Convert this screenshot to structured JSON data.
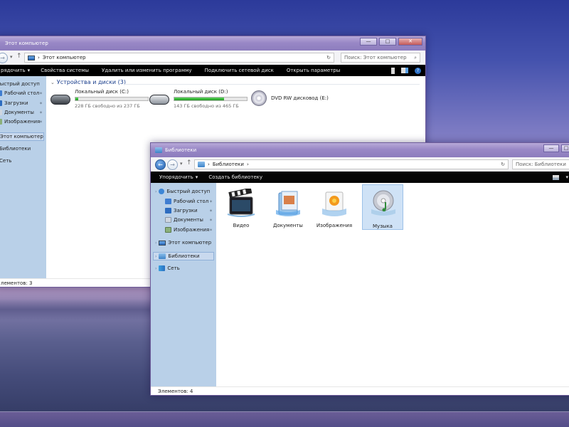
{
  "window_pc": {
    "title": "Этот компьютер",
    "address": "Этот компьютер",
    "search_placeholder": "Поиск: Этот компьютер",
    "toolbar": [
      "Свойства системы",
      "Удалить или изменить программу",
      "Подключить сетевой диск",
      "Открыть параметры"
    ],
    "toolbar_left": "рядочить",
    "section_title": "Устройства и диски (3)",
    "drives": [
      {
        "name": "Локальный диск (C:)",
        "free": "228 ГБ свободно из 237 ГБ",
        "used_fraction": 0.04
      },
      {
        "name": "Локальный диск (D:)",
        "free": "143 ГБ свободно из 465 ГБ",
        "used_fraction": 0.69
      },
      {
        "name": "DVD RW дисковод (E:)"
      }
    ],
    "sidebar": [
      {
        "label": "Быстрый доступ"
      },
      {
        "label": "Рабочий стол"
      },
      {
        "label": "Загрузки"
      },
      {
        "label": "Документы"
      },
      {
        "label": "Изображения"
      },
      {
        "label": "Этот компьютер"
      },
      {
        "label": "Библиотеки"
      },
      {
        "label": "Сеть"
      }
    ],
    "status": "лементов: 3"
  },
  "window_lib": {
    "title": "Библиотеки",
    "address": "Библиотеки",
    "search_placeholder": "Поиск: Библиотеки",
    "toolbar": [
      "Упорядочить",
      "Создать библиотеку"
    ],
    "sidebar": [
      {
        "label": "Быстрый доступ"
      },
      {
        "label": "Рабочий стол"
      },
      {
        "label": "Загрузки"
      },
      {
        "label": "Документы"
      },
      {
        "label": "Изображения"
      },
      {
        "label": "Этот компьютер"
      },
      {
        "label": "Библиотеки"
      },
      {
        "label": "Сеть"
      }
    ],
    "libraries": [
      {
        "label": "Видео",
        "icon": "video-library-icon"
      },
      {
        "label": "Документы",
        "icon": "documents-library-icon"
      },
      {
        "label": "Изображения",
        "icon": "pictures-library-icon"
      },
      {
        "label": "Музыка",
        "icon": "music-library-icon"
      }
    ],
    "status": "Элементов: 4"
  },
  "glyphs": {
    "back": "←",
    "forward": "→",
    "up": "↑",
    "refresh": "↻",
    "dropdown": "▾",
    "chevron": "›",
    "search": "⌕",
    "help": "?",
    "pin": "✶",
    "expand": "›",
    "minimize": "—",
    "maximize": "□",
    "close": "✕"
  }
}
